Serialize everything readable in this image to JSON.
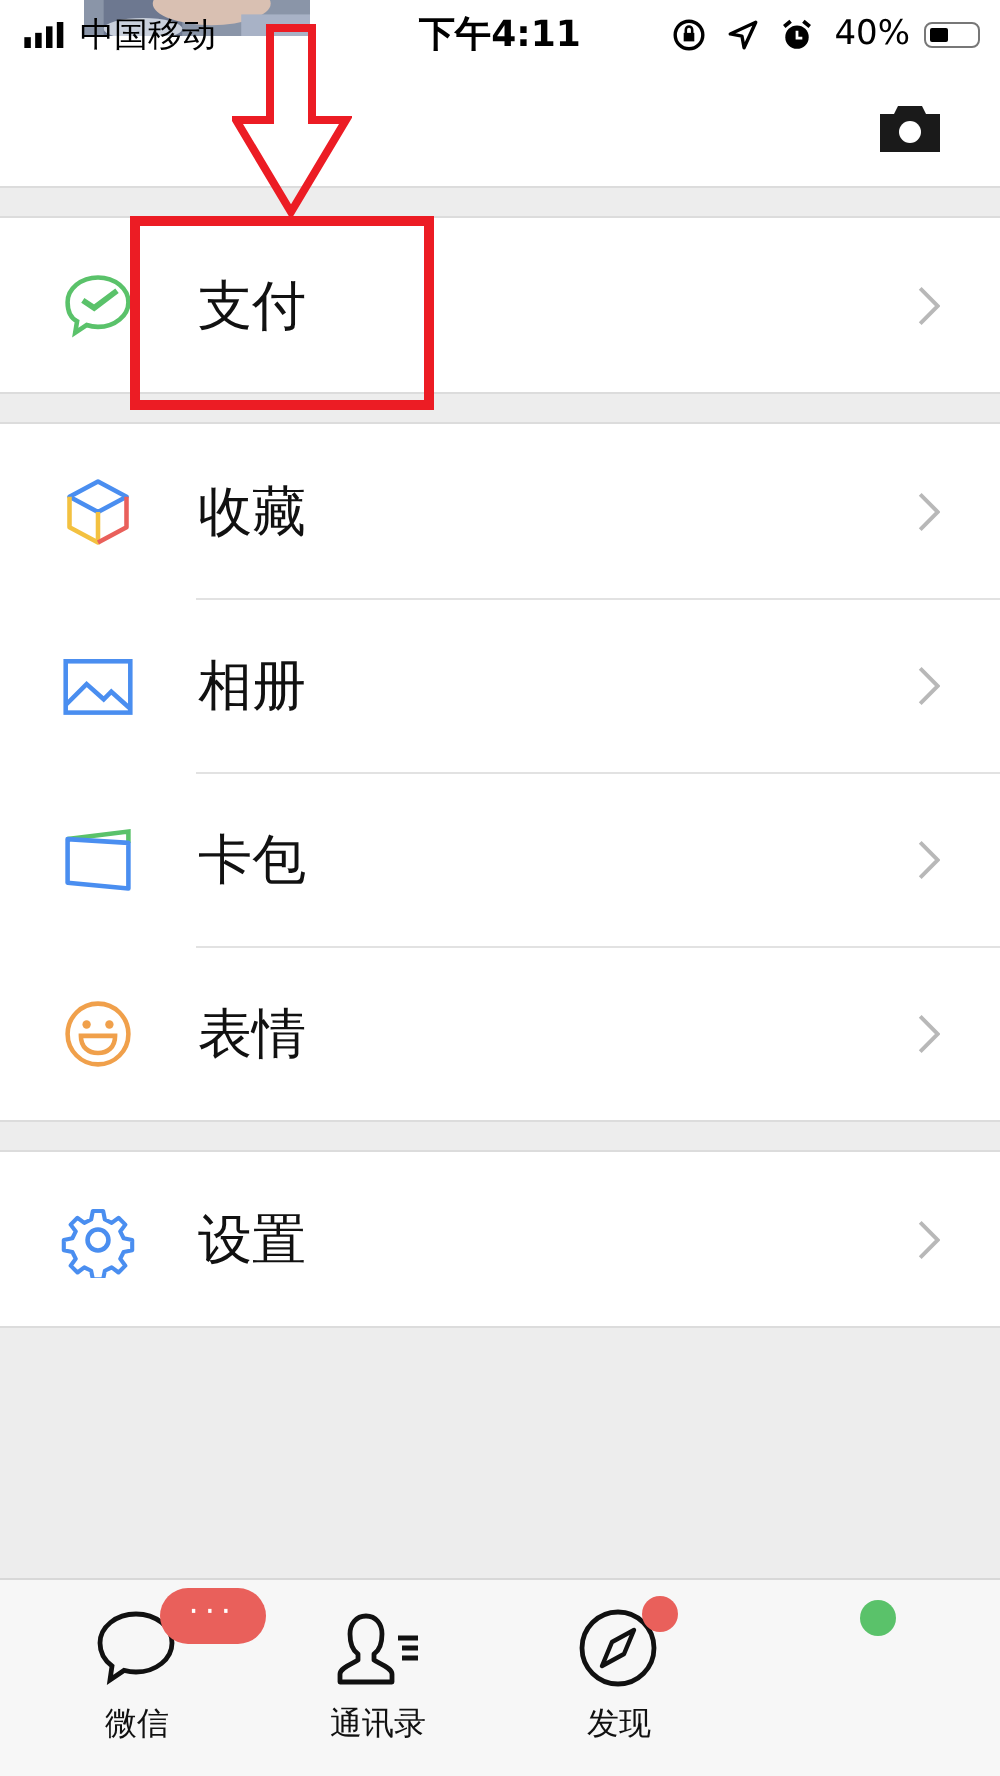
{
  "status_bar": {
    "carrier": "中国移动",
    "time": "下午4:11",
    "battery": "40%"
  },
  "groups": [
    [
      {
        "label": "支付",
        "kind": "pay"
      }
    ],
    [
      {
        "label": "收藏",
        "kind": "favorites"
      },
      {
        "label": "相册",
        "kind": "album"
      },
      {
        "label": "卡包",
        "kind": "cards"
      },
      {
        "label": "表情",
        "kind": "sticker"
      }
    ],
    [
      {
        "label": "设置",
        "kind": "settings"
      }
    ]
  ],
  "annotation": {
    "highlight": true,
    "arrow": true
  },
  "tab_bar": [
    {
      "kind": "chats",
      "label": "微信",
      "badge": "···"
    },
    {
      "kind": "contacts",
      "label": "通讯录"
    },
    {
      "kind": "discover",
      "label": "发现",
      "dot": {
        "color": "#e9605b"
      }
    },
    {
      "kind": "me",
      "dot": {
        "color": "#5ac26a"
      }
    }
  ]
}
